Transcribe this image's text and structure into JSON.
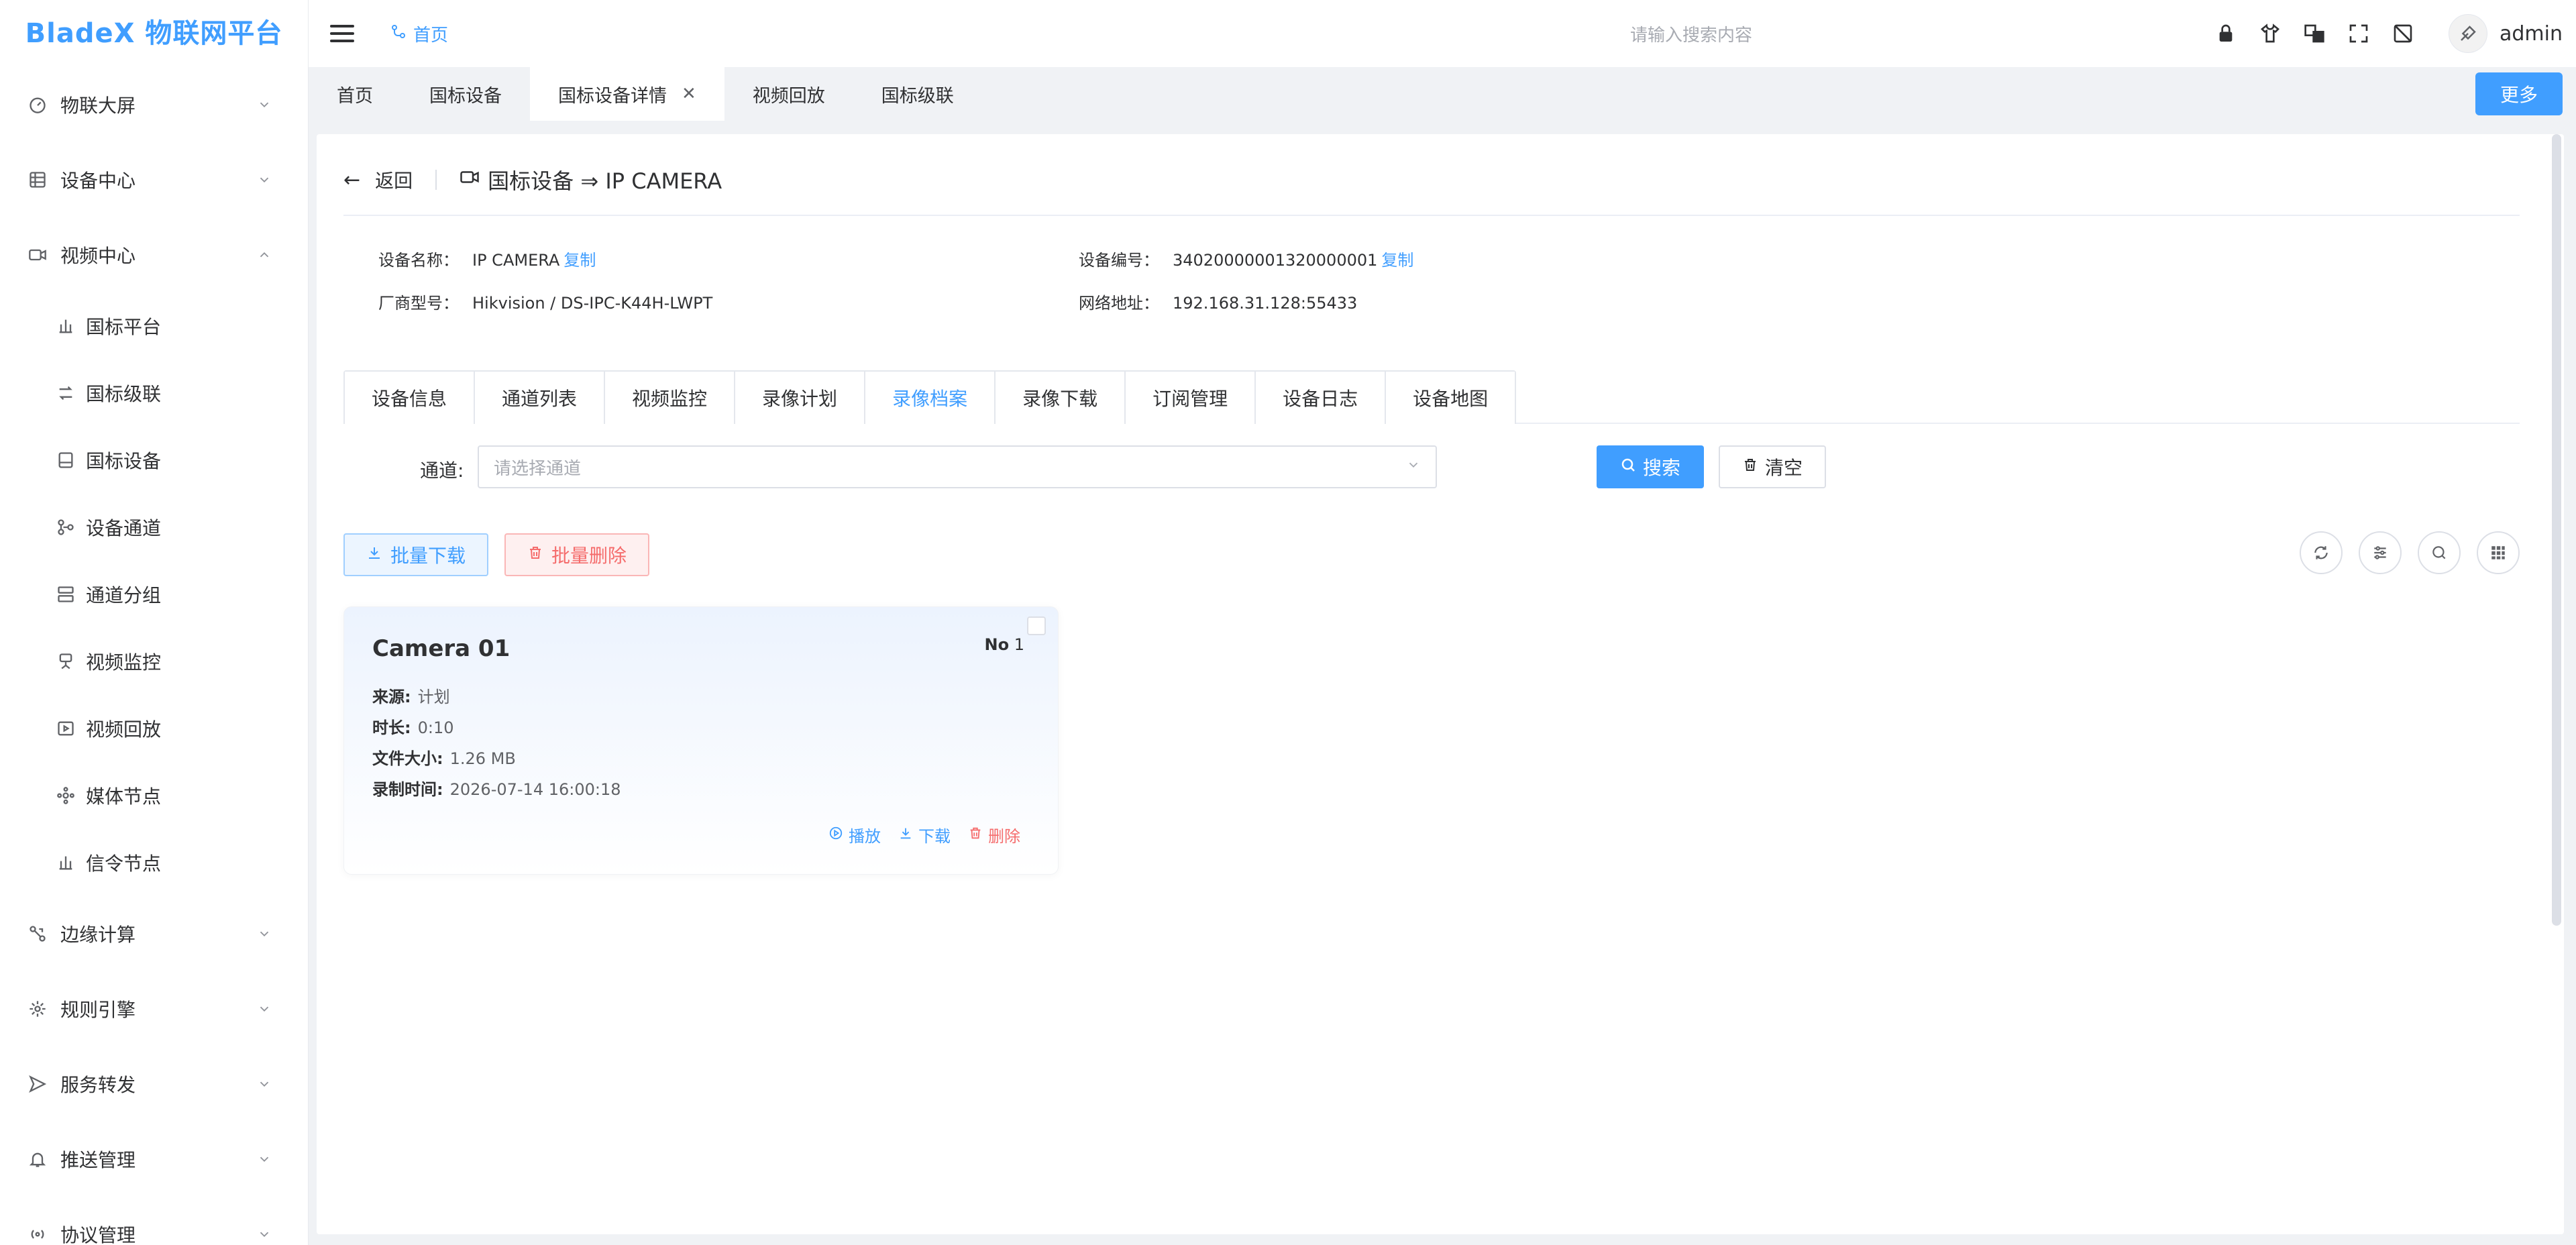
{
  "app": {
    "logo": "BladeX 物联网平台"
  },
  "sidebar": {
    "items": [
      {
        "label": "物联大屏",
        "icon": "dashboard-icon"
      },
      {
        "label": "设备中心",
        "icon": "device-center-icon"
      },
      {
        "label": "视频中心",
        "icon": "video-center-icon",
        "expanded": true
      },
      {
        "label": "边缘计算",
        "icon": "edge-computing-icon"
      },
      {
        "label": "规则引擎",
        "icon": "rule-engine-icon"
      },
      {
        "label": "服务转发",
        "icon": "forward-icon"
      },
      {
        "label": "推送管理",
        "icon": "bell-icon"
      },
      {
        "label": "协议管理",
        "icon": "protocol-icon"
      }
    ],
    "video_sub": [
      {
        "label": "国标平台"
      },
      {
        "label": "国标级联"
      },
      {
        "label": "国标设备"
      },
      {
        "label": "设备通道"
      },
      {
        "label": "通道分组"
      },
      {
        "label": "视频监控"
      },
      {
        "label": "视频回放"
      },
      {
        "label": "媒体节点"
      },
      {
        "label": "信令节点"
      }
    ]
  },
  "header": {
    "breadcrumb": "首页",
    "search_placeholder": "请输入搜索内容",
    "username": "admin"
  },
  "tags": {
    "items": [
      "首页",
      "国标设备",
      "国标设备详情",
      "视频回放",
      "国标级联"
    ],
    "active_index": 2,
    "more_label": "更多"
  },
  "page": {
    "back_label": "返回",
    "title": "国标设备 ⇒ IP CAMERA",
    "info": {
      "name_label": "设备名称：",
      "name_value": "IP CAMERA",
      "code_label": "设备编号：",
      "code_value": "34020000001320000001",
      "vendor_label": "厂商型号：",
      "vendor_value": "Hikvision / DS-IPC-K44H-LWPT",
      "addr_label": "网络地址：",
      "addr_value": "192.168.31.128:55433",
      "copy_label": "复制"
    },
    "tabs": [
      "设备信息",
      "通道列表",
      "视频监控",
      "录像计划",
      "录像档案",
      "录像下载",
      "订阅管理",
      "设备日志",
      "设备地图"
    ],
    "active_tab": 4,
    "filter": {
      "channel_label": "通道:",
      "channel_placeholder": "请选择通道",
      "search_label": "搜索",
      "clear_label": "清空"
    },
    "batch_download_label": "批量下载",
    "batch_delete_label": "批量删除"
  },
  "records": [
    {
      "title": "Camera 01",
      "no_label": "No",
      "no_value": "1",
      "source_label": "来源:",
      "source_value": "计划",
      "duration_label": "时长:",
      "duration_value": "0:10",
      "size_label": "文件大小:",
      "size_value": "1.26 MB",
      "time_label": "录制时间:",
      "time_value": "2026-07-14 16:00:18",
      "play_label": "播放",
      "download_label": "下载",
      "delete_label": "删除"
    }
  ],
  "colors": {
    "primary": "#409eff",
    "danger": "#f56c6c"
  }
}
